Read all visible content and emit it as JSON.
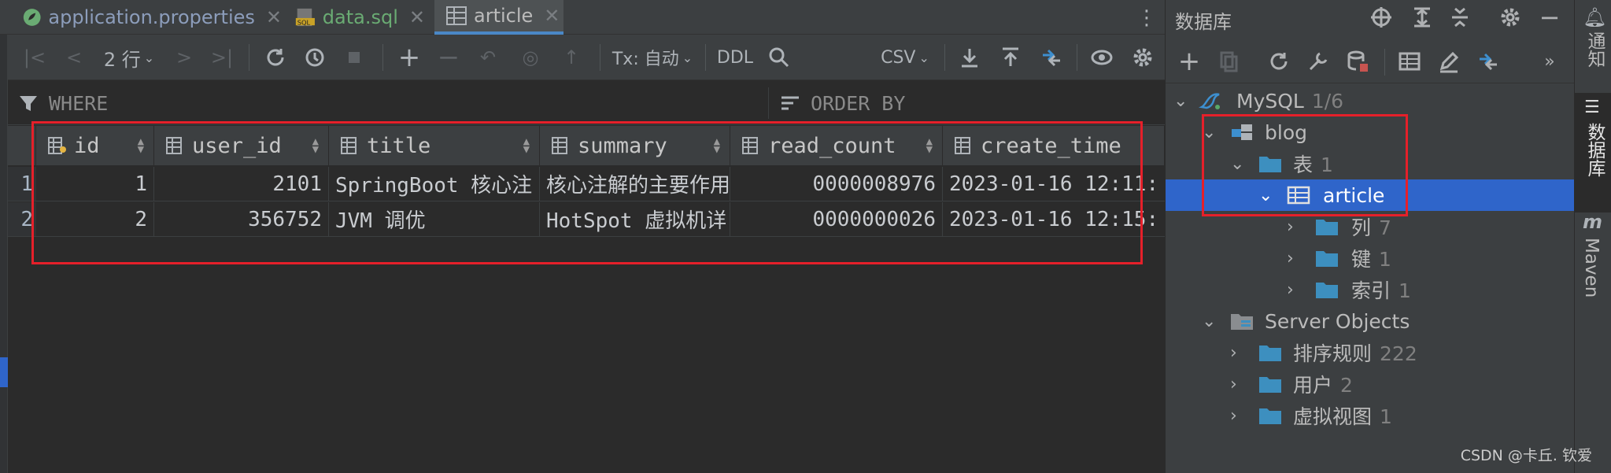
{
  "tabs": [
    {
      "label": "application.properties",
      "close": "✕"
    },
    {
      "label": "data.sql",
      "close": "✕"
    },
    {
      "label": "article",
      "close": "✕"
    }
  ],
  "toolbar": {
    "rows": "2 行",
    "tx": "Tx: 自动",
    "ddl": "DDL",
    "csv": "CSV"
  },
  "filter": {
    "where": "WHERE",
    "order": "ORDER BY"
  },
  "grid": {
    "columns": [
      "id",
      "user_id",
      "title",
      "summary",
      "read_count",
      "create_time"
    ],
    "rows": [
      {
        "n": "1",
        "id": "1",
        "user_id": "2101",
        "title": "SpringBoot 核心注",
        "summary": "核心注解的主要作用",
        "read_count": "0000008976",
        "create_time": "2023-01-16 12:11:"
      },
      {
        "n": "2",
        "id": "2",
        "user_id": "356752",
        "title": "JVM 调优",
        "summary": "HotSpot 虚拟机详",
        "read_count": "0000000026",
        "create_time": "2023-01-16 12:15:"
      }
    ]
  },
  "db": {
    "title": "数据库",
    "tree": [
      {
        "label": "MySQL",
        "count": "1/6"
      },
      {
        "label": "blog",
        "count": ""
      },
      {
        "label": "表",
        "count": "1"
      },
      {
        "label": "article",
        "count": ""
      },
      {
        "label": "列",
        "count": "7"
      },
      {
        "label": "键",
        "count": "1"
      },
      {
        "label": "索引",
        "count": "1"
      },
      {
        "label": "Server Objects",
        "count": ""
      },
      {
        "label": "排序规则",
        "count": "222"
      },
      {
        "label": "用户",
        "count": "2"
      },
      {
        "label": "虚拟视图",
        "count": "1"
      }
    ]
  },
  "right_strip": {
    "notify": "通知",
    "db": "数据库",
    "maven": "Maven"
  },
  "watermark": "CSDN @卡丘. 钦爱",
  "colors": {
    "accent": "#2f65ca",
    "highlight": "#e5202a",
    "folder": "#3d8fbf"
  }
}
